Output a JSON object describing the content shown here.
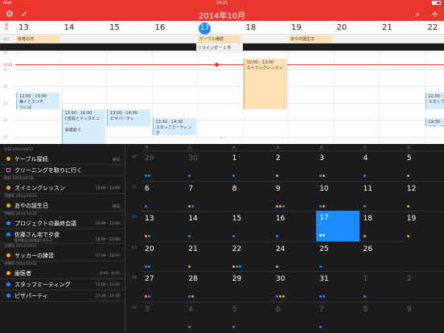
{
  "status": {
    "carrier": "iPad",
    "wifi": "wifi-icon",
    "time": "10:21",
    "battery": "battery-icon"
  },
  "nav": {
    "title": "2014年10月",
    "settings_icon": "gear-icon",
    "check_icon": "check-icon",
    "search_icon": "search-icon",
    "add_icon": "plus-icon"
  },
  "week": {
    "label_top": "週",
    "label_num": "42",
    "days": [
      {
        "num": "13"
      },
      {
        "num": "14"
      },
      {
        "num": "15"
      },
      {
        "num": "16"
      },
      {
        "num": "17",
        "today": true
      },
      {
        "num": "18"
      },
      {
        "num": "19"
      },
      {
        "num": "20"
      },
      {
        "num": "21"
      },
      {
        "num": "22"
      }
    ]
  },
  "allday": {
    "label": "終日",
    "events": [
      {
        "title": "体育の日",
        "col": 0,
        "span": 1
      },
      {
        "title": "ケーブル接続",
        "col": 4,
        "span": 1
      },
      {
        "title": "あやの誕生日",
        "col": 6,
        "span": 1
      }
    ],
    "reminder": "リマインダー 1 件"
  },
  "timeline": {
    "hours": [
      "10",
      "",
      "11",
      "",
      "12",
      "",
      "13",
      "",
      "14",
      "",
      "15",
      "",
      "16"
    ],
    "now_label": "10:21",
    "events": [
      {
        "time": "10:00 - 13:00",
        "title": "スイミングレッスン",
        "color": "orange",
        "col": 5
      },
      {
        "time": "12:00 - 13:00",
        "title": "美人とランチ",
        "sub": "つくば",
        "color": "blue",
        "col": 0
      },
      {
        "time": "13:00 - 16:00",
        "title": "C部長とインタビュー",
        "sub": "会議室 C",
        "color": "blue",
        "col": 1
      },
      {
        "time": "13:00 - 14:00",
        "title": "ピザパーティ",
        "color": "blue",
        "col": 2
      },
      {
        "time": "13:30 - 14:30",
        "title": "スタッフミーティング",
        "color": "blue",
        "col": 3
      },
      {
        "time": "12:00 - 13:00",
        "title": "スタッフミ",
        "color": "blue",
        "col": 9
      },
      {
        "time": "13:30 - 14:00",
        "title": "スタッフミ",
        "color": "blue",
        "col": 9
      }
    ]
  },
  "agenda": [
    {
      "header": "今日 2014/10/17"
    },
    {
      "title": "ケーブル接続",
      "time": "終日",
      "dot": "#f5a623",
      "kind": "dot"
    },
    {
      "title": "クリーニングを取りに行く",
      "time": "",
      "dot": "#c070e0",
      "kind": "box"
    },
    {
      "header": "明日 2014/10/18"
    },
    {
      "title": "スイミングレッスン",
      "time": "10:00 - 13:00",
      "dot": "#f5a623",
      "kind": "dot"
    },
    {
      "header": "日曜日 2014/10/19"
    },
    {
      "title": "あやの誕生日",
      "time": "終日",
      "dot": "#f5a623",
      "kind": "dot"
    },
    {
      "header": "月曜日 2014/10/20"
    },
    {
      "title": "プロジェクトの最終会議",
      "time": "10:00 - 12:00",
      "dot": "#1a8cff",
      "kind": "dot"
    },
    {
      "title": "佐藤さん宅で夕食",
      "sub": "東京都品川区南品川1-2-3",
      "time": "18:00 - 22:00",
      "dot": "#1a8cff",
      "kind": "dot"
    },
    {
      "header": "火曜日 2014/10/21"
    },
    {
      "title": "サッカーの練習",
      "time": "17:00 - 18:30",
      "dot": "#f5a623",
      "kind": "dot"
    },
    {
      "header": "水曜日 2014/10/22"
    },
    {
      "title": "歯医者",
      "time": "8:00 - 8:45",
      "dot": "#f5a623",
      "kind": "dot"
    },
    {
      "title": "スタッフミーティング",
      "time": "12:00 - 13:00",
      "dot": "#1a8cff",
      "kind": "dot"
    },
    {
      "title": "ピザパーティ",
      "time": "13:30 - 14:30",
      "dot": "#1a8cff",
      "kind": "dot"
    }
  ],
  "month": {
    "weekdays": [
      "月",
      "火",
      "水",
      "木",
      "金",
      "土",
      "日"
    ],
    "weeks": [
      {
        "num": "40",
        "days": [
          {
            "n": "29",
            "other": true,
            "dots": [
              "#1a8cff",
              "#1a8cff"
            ]
          },
          {
            "n": "30",
            "other": true,
            "dots": [
              "#1a8cff"
            ]
          },
          {
            "n": "1",
            "dots": [
              "#1a8cff"
            ]
          },
          {
            "n": "2",
            "dots": [
              "#f5a623"
            ]
          },
          {
            "n": "3",
            "dots": [
              "#1a8cff",
              "#f5a623"
            ]
          },
          {
            "n": "4",
            "dots": [
              "#1a8cff"
            ]
          },
          {
            "n": "5",
            "dots": [
              "#f5a623"
            ]
          }
        ]
      },
      {
        "num": "41",
        "days": [
          {
            "n": "6",
            "dots": [
              "#1a8cff"
            ]
          },
          {
            "n": "7",
            "dots": [
              "#f5a623",
              "#1a8cff"
            ]
          },
          {
            "n": "8",
            "dots": []
          },
          {
            "n": "9",
            "dots": [
              "#f5a623",
              "#f5a623",
              "#1a8cff"
            ]
          },
          {
            "n": "10",
            "dots": [
              "#1a8cff",
              "#f5a623"
            ]
          },
          {
            "n": "11",
            "dots": [
              "#1a8cff"
            ]
          },
          {
            "n": "12",
            "dots": [
              "#f5a623"
            ]
          }
        ]
      },
      {
        "num": "42",
        "days": [
          {
            "n": "13",
            "dots": [
              "#f5a623",
              "#1a8cff"
            ]
          },
          {
            "n": "14",
            "dots": [
              "#1a8cff"
            ]
          },
          {
            "n": "15",
            "dots": [
              "#1a8cff"
            ]
          },
          {
            "n": "16",
            "dots": [
              "#1a8cff"
            ]
          },
          {
            "n": "17",
            "sel": true,
            "dots": [
              "#ffffff",
              "#ffffff"
            ]
          },
          {
            "n": "18",
            "dots": [
              "#f5a623"
            ]
          },
          {
            "n": "19",
            "dots": [
              "#f5a623"
            ]
          }
        ]
      },
      {
        "num": "43",
        "days": [
          {
            "n": "20",
            "dots": [
              "#1a8cff",
              "#1a8cff"
            ]
          },
          {
            "n": "21",
            "dots": [
              "#f5a623"
            ]
          },
          {
            "n": "22",
            "dots": [
              "#f5a623",
              "#1a8cff",
              "#1a8cff"
            ]
          },
          {
            "n": "24",
            "dots": [
              "#f5a623"
            ]
          },
          {
            "n": "25",
            "dots": [
              "#1a8cff"
            ]
          },
          {
            "n": "26",
            "dots": []
          }
        ]
      },
      {
        "num": "44",
        "days": [
          {
            "n": "27",
            "dots": [
              "#f5a623",
              "#1a8cff"
            ]
          },
          {
            "n": "28",
            "dots": [
              "#1a8cff",
              "#f5a623"
            ]
          },
          {
            "n": "29",
            "dots": []
          },
          {
            "n": "30",
            "dots": [
              "#1a8cff",
              "#f5a623",
              "#f5a623"
            ]
          },
          {
            "n": "31",
            "dots": [
              "#1a8cff",
              "#1a8cff"
            ]
          },
          {
            "n": "1",
            "other": true,
            "dots": [
              "#1a8cff"
            ]
          },
          {
            "n": "2",
            "other": true,
            "dots": []
          }
        ]
      },
      {
        "num": "45",
        "days": [
          {
            "n": "3",
            "other": true,
            "dots": []
          },
          {
            "n": "4",
            "other": true,
            "dots": [
              "#1a8cff"
            ]
          },
          {
            "n": "5",
            "other": true,
            "dots": [
              "#1a8cff"
            ]
          },
          {
            "n": "6",
            "other": true,
            "dots": []
          },
          {
            "n": "7",
            "other": true,
            "dots": [
              "#1a8cff"
            ]
          },
          {
            "n": "8",
            "other": true,
            "dots": []
          },
          {
            "n": "9",
            "other": true,
            "dots": []
          }
        ]
      }
    ]
  },
  "colors": {
    "accent": "#e8352e",
    "today": "#1a8cff",
    "orange": "#f5a623",
    "blue": "#1a8cff"
  }
}
